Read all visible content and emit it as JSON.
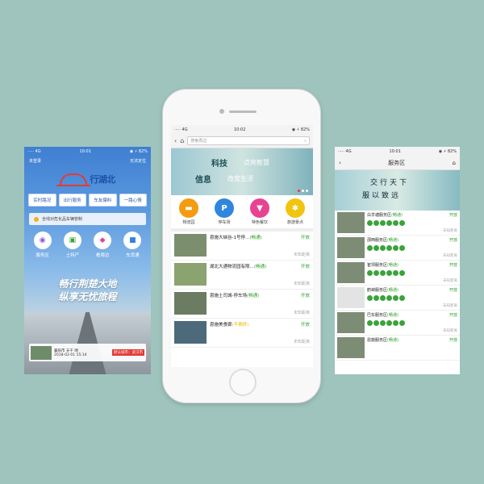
{
  "left": {
    "status": {
      "left": "····· 4G",
      "time": "10:01",
      "right": "◉ ⚡ 82%"
    },
    "user": "未登录",
    "location": "无法定位",
    "app_title": "行湖北",
    "tabs": [
      "实时路况",
      "出行服务",
      "车友爆料",
      "一路心情"
    ],
    "notice": "全线对危化品车辆管制",
    "icons": [
      {
        "label": "服务区",
        "icon": "bowl-icon"
      },
      {
        "label": "土特产",
        "icon": "basket-icon"
      },
      {
        "label": "看周边",
        "icon": "bag-icon"
      },
      {
        "label": "车货通",
        "icon": "truck-icon"
      }
    ],
    "slogan_1": "畅行荆楚大地",
    "slogan_2": "纵享无忧旅程",
    "card": {
      "line1": "襄阳市 天干 晴",
      "line2": "2018-02-01 15:14",
      "location": "默认城市：武汉市"
    }
  },
  "center": {
    "status": {
      "left": "····· 4G",
      "time": "10:02",
      "right": "◉ ⚡ 82%"
    },
    "search_placeholder": "搜索周边",
    "banner": {
      "w1": "科技",
      "w2": "点亮智慧",
      "w3": "信息",
      "w4": "改变生活"
    },
    "categories": [
      {
        "label": "物流园",
        "icon": "truck",
        "color": "#f39c12"
      },
      {
        "label": "停车场",
        "icon": "P",
        "color": "#2e86de"
      },
      {
        "label": "特色餐饮",
        "icon": "cup",
        "color": "#e84393"
      },
      {
        "label": "旅游景点",
        "icon": "sun",
        "color": "#f1c40f"
      }
    ],
    "items": [
      {
        "name": "恩施大峡谷-1号停…",
        "status": "(畅通)",
        "status_class": "st-ok",
        "open": "开放",
        "distance": "未知距离"
      },
      {
        "name": "湖北大通物流园有限…",
        "status": "(畅通)",
        "status_class": "st-ok",
        "open": "开放",
        "distance": "未知距离"
      },
      {
        "name": "恩施土司城-停车场",
        "status": "(畅通)",
        "status_class": "st-ok",
        "open": "开放",
        "distance": "未知距离"
      },
      {
        "name": "恩施美食廊",
        "status": "(不拥挤)",
        "status_class": "st-busy",
        "open": "开放",
        "distance": "未知距离"
      }
    ]
  },
  "right": {
    "status": {
      "left": "····· 4G",
      "time": "10:01",
      "right": "◉ ⚡ 82%"
    },
    "title": "服务区",
    "banner": {
      "c1": "交行天下",
      "c2": "服以致远"
    },
    "items": [
      {
        "name": "白羊塘服务区",
        "status": "(畅通)",
        "open": "开放",
        "distance": "未知距离",
        "placeholder": false
      },
      {
        "name": "邵西服务区",
        "status": "(畅通)",
        "open": "开放",
        "distance": "未知距离",
        "placeholder": false
      },
      {
        "name": "崔坝服务区",
        "status": "(畅通)",
        "open": "开放",
        "distance": "未知距离",
        "placeholder": false
      },
      {
        "name": "鹤峡服务区",
        "status": "(畅通)",
        "open": "开放",
        "distance": "未知距离",
        "placeholder": true
      },
      {
        "name": "巴东服务区",
        "status": "(畅通)",
        "open": "开放",
        "distance": "未知距离",
        "placeholder": false
      },
      {
        "name": "恩施服务区",
        "status": "(畅通)",
        "open": "开放",
        "distance": "",
        "placeholder": false
      }
    ]
  }
}
